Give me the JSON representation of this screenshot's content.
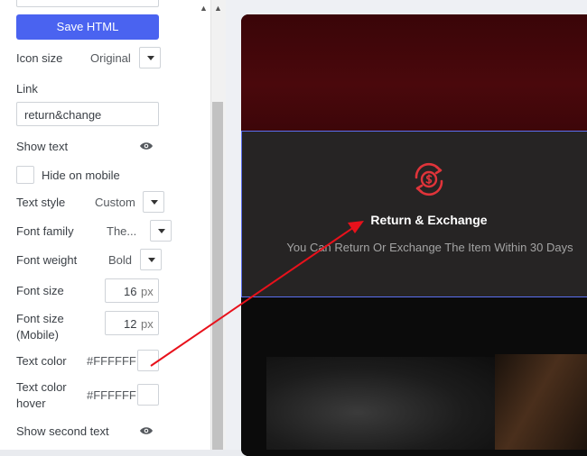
{
  "panel": {
    "save_label": "Save HTML",
    "icon_size": {
      "label": "Icon size",
      "value": "Original"
    },
    "link": {
      "label": "Link",
      "value": "return&change"
    },
    "show_text": {
      "label": "Show text"
    },
    "hide_on_mobile": {
      "label": "Hide on mobile",
      "checked": false
    },
    "text_style": {
      "label": "Text style",
      "value": "Custom"
    },
    "font_family": {
      "label": "Font family",
      "value": "The..."
    },
    "font_weight": {
      "label": "Font weight",
      "value": "Bold"
    },
    "font_size": {
      "label": "Font size",
      "value": "16",
      "unit": "px"
    },
    "font_size_mobile": {
      "label_line1": "Font size",
      "label_line2": "(Mobile)",
      "value": "12",
      "unit": "px"
    },
    "text_color": {
      "label": "Text color",
      "value": "#FFFFFF"
    },
    "text_color_hover": {
      "label_line1": "Text color",
      "label_line2": "hover",
      "value": "#FFFFFF"
    },
    "show_second_text": {
      "label": "Show second text"
    }
  },
  "preview": {
    "feature_title": "Return & Exchange",
    "feature_desc": "You Can Return Or Exchange The Item Within 30 Days",
    "accent_color": "#e0343a",
    "selection_color": "#5b6ff0"
  },
  "icons": {
    "eye": "eye-icon",
    "dropdown": "chevron-down-icon",
    "feature": "currency-exchange-icon"
  }
}
